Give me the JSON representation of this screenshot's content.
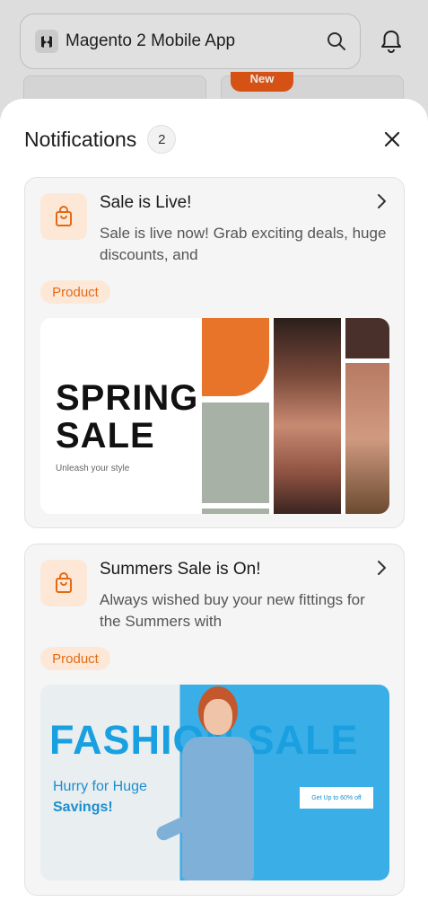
{
  "app": {
    "title": "Magento 2 Mobile App",
    "background_badge": "New"
  },
  "notifications": {
    "title": "Notifications",
    "count": "2",
    "items": [
      {
        "title": "Sale is Live!",
        "body": "Sale is live now! Grab exciting deals, huge discounts, and",
        "tag": "Product",
        "banner": {
          "headline_1": "SPRING",
          "headline_2": "SALE",
          "tagline": "Unleash your style"
        }
      },
      {
        "title": "Summers Sale is On!",
        "body": "Always wished buy your new fittings for the Summers with",
        "tag": "Product",
        "banner": {
          "headline": "FASHION SALE",
          "sub_1": "Hurry for Huge",
          "sub_2": "Savings!",
          "cta": "Get Up to 60% off"
        }
      }
    ]
  },
  "colors": {
    "accent": "#e36a14",
    "tag_bg": "#fde8d8",
    "fashion_bg": "#3aaee6",
    "fashion_text": "#1aa0e0"
  }
}
